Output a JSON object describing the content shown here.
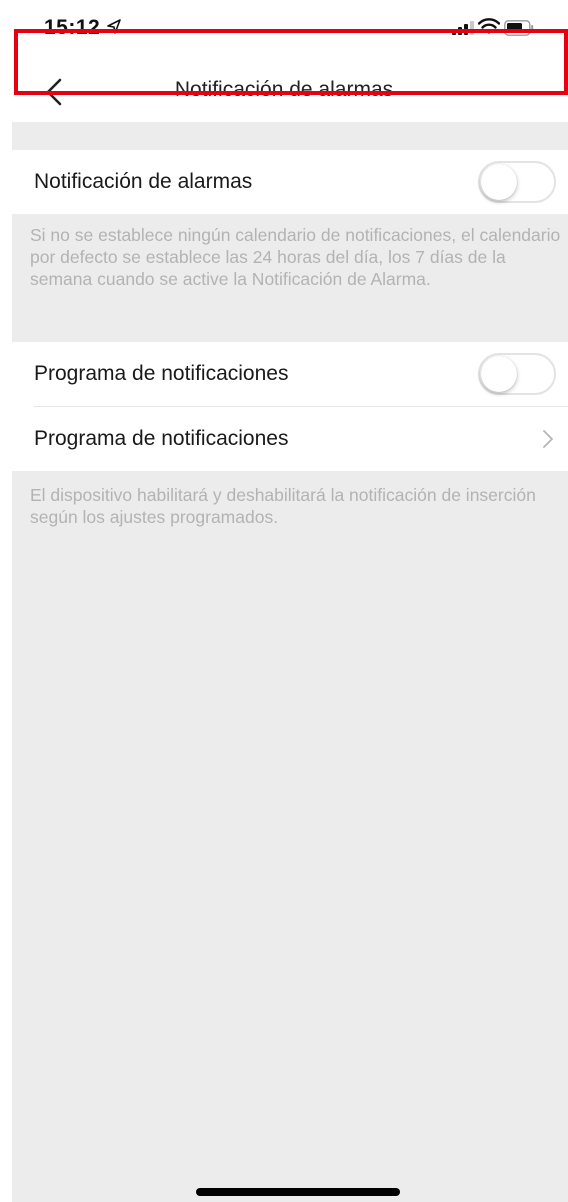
{
  "status_bar": {
    "time": "15:12",
    "icons": [
      "location-arrow-icon",
      "cellular-signal-icon",
      "wifi-icon",
      "battery-icon"
    ]
  },
  "nav": {
    "title": "Notificación de alarmas",
    "back_icon": "chevron-left-icon"
  },
  "settings": {
    "alarm_notification": {
      "label": "Notificación de alarmas",
      "enabled": false
    },
    "alarm_notification_help": "Si no se establece ningún calendario de notificaciones, el calendario por defecto se establece las 24 horas del día, los 7 días de la semana cuando se active la Notificación de Alarma.",
    "schedule_toggle": {
      "label": "Programa de notificaciones",
      "enabled": false
    },
    "schedule_link": {
      "label": "Programa de notificaciones",
      "icon": "chevron-right-icon"
    },
    "schedule_help": "El dispositivo habilitará y deshabilitará la notificación de inserción según los ajustes programados."
  },
  "colors": {
    "highlight": "#e60012",
    "background": "#ececec",
    "help_text": "#b3b3b3"
  }
}
